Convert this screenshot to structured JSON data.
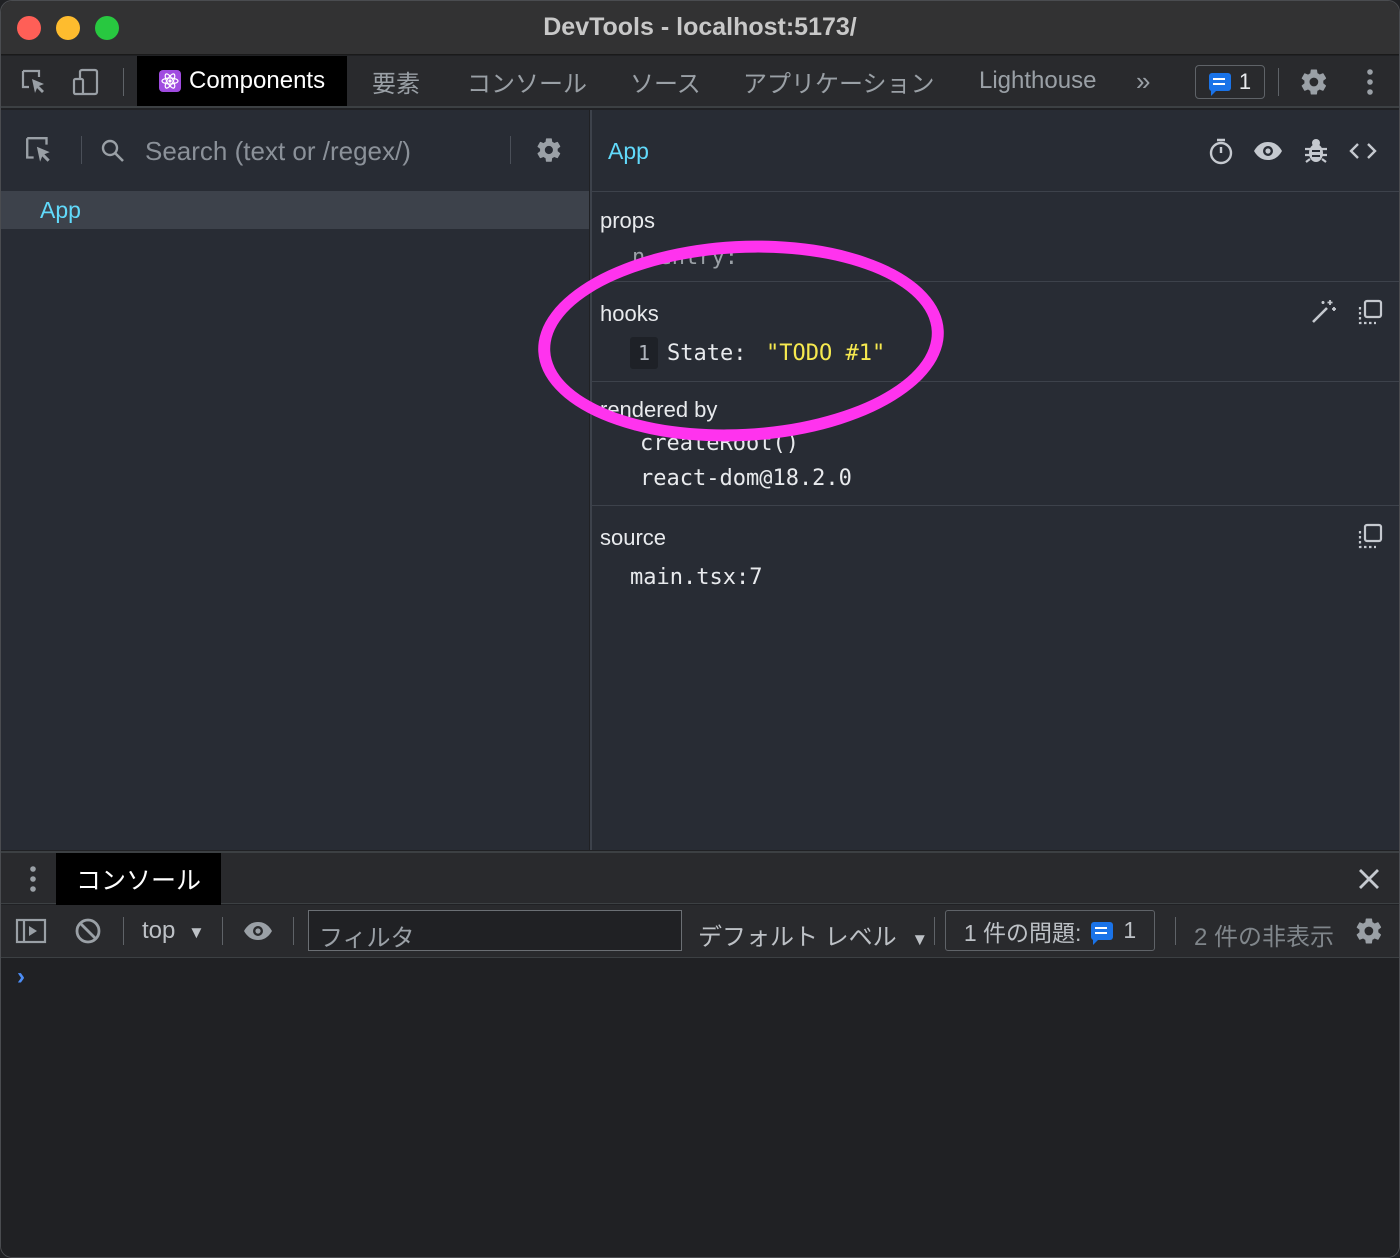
{
  "window": {
    "title": "DevTools - localhost:5173/"
  },
  "tabs": [
    {
      "label": "Components",
      "active": true
    },
    {
      "label": "要素"
    },
    {
      "label": "コンソール"
    },
    {
      "label": "ソース"
    },
    {
      "label": "アプリケーション"
    },
    {
      "label": "Lighthouse"
    }
  ],
  "toolbar": {
    "more_tabs": "»",
    "issues_count": "1"
  },
  "components": {
    "search_placeholder": "Search (text or /regex/)",
    "tree": [
      {
        "name": "App"
      }
    ],
    "selected": "App",
    "props_label": "props",
    "props_partial": "n   entry:",
    "hooks_label": "hooks",
    "hook_index": "1",
    "hook_name": "State:",
    "hook_value": "\"TODO #1\"",
    "rendered_by_label": "rendered by",
    "rendered_by": [
      "createRoot()",
      "react-dom@18.2.0"
    ],
    "source_label": "source",
    "source_value": "main.tsx:7"
  },
  "drawer": {
    "tab": "コンソール",
    "context": "top",
    "filter_placeholder": "フィルタ",
    "level": "デフォルト レベル",
    "issues_label": "1 件の問題:",
    "issues_count": "1",
    "hidden": "2 件の非表示",
    "prompt": "›"
  },
  "colors": {
    "accent_react": "#61dafb",
    "highlight": "#ff33ee",
    "string": "#f6e94f"
  }
}
